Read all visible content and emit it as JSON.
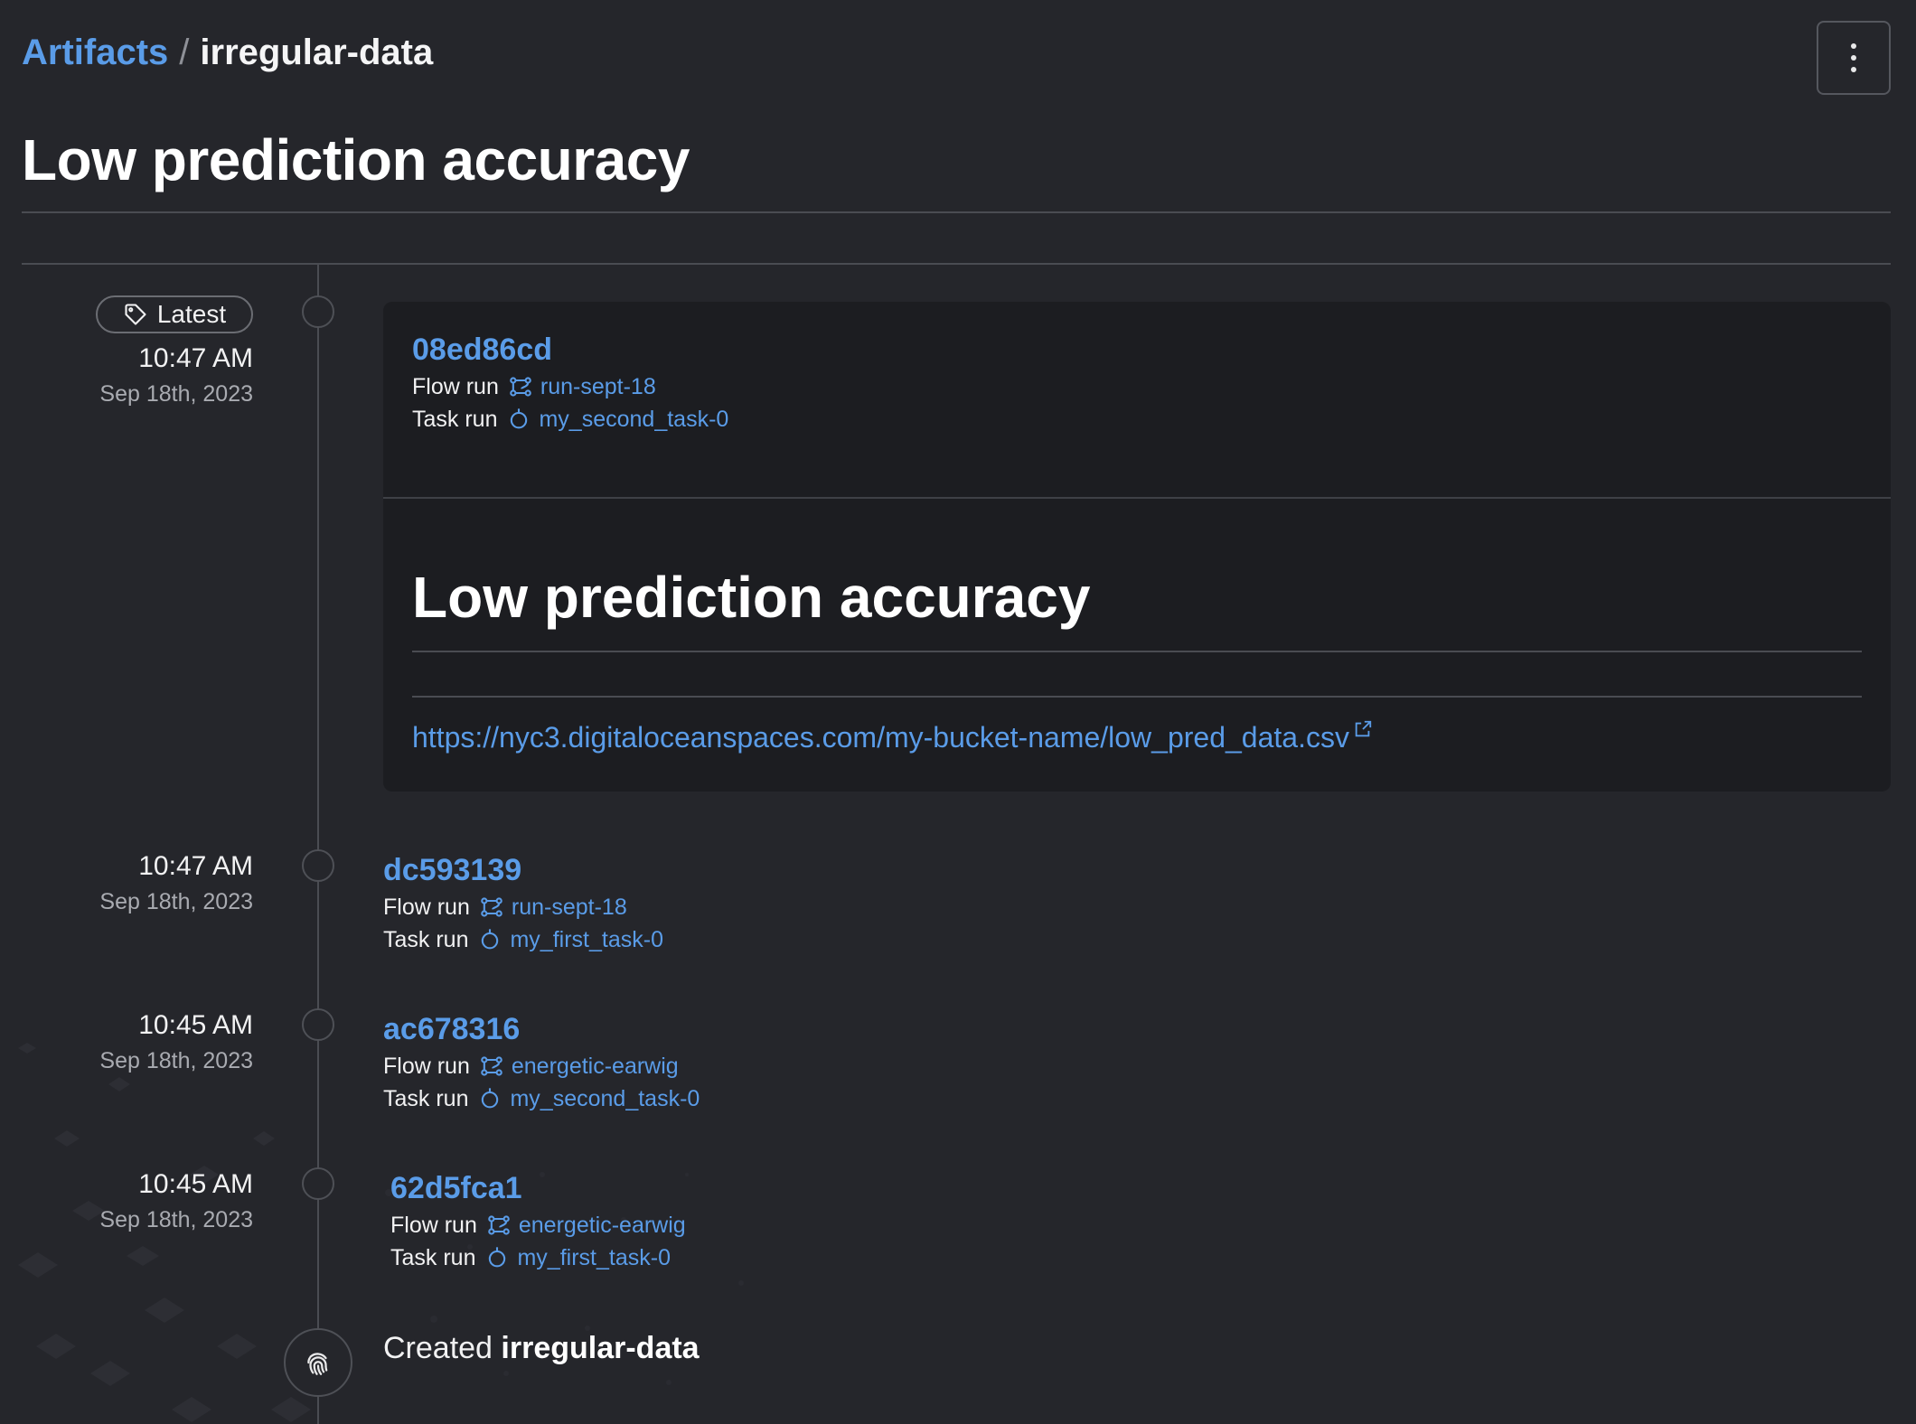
{
  "breadcrumb": {
    "parent": "Artifacts",
    "separator": "/",
    "current": "irregular-data"
  },
  "page_title": "Low prediction accuracy",
  "latest_badge": "Latest",
  "labels": {
    "flow_run": "Flow run",
    "task_run": "Task run"
  },
  "entries": [
    {
      "time": "10:47 AM",
      "date": "Sep 18th, 2023",
      "hash": "08ed86cd",
      "flow_run": "run-sept-18",
      "task_run": "my_second_task-0",
      "content": {
        "title": "Low prediction accuracy",
        "link": "https://nyc3.digitaloceanspaces.com/my-bucket-name/low_pred_data.csv"
      }
    },
    {
      "time": "10:47 AM",
      "date": "Sep 18th, 2023",
      "hash": "dc593139",
      "flow_run": "run-sept-18",
      "task_run": "my_first_task-0"
    },
    {
      "time": "10:45 AM",
      "date": "Sep 18th, 2023",
      "hash": "ac678316",
      "flow_run": "energetic-earwig",
      "task_run": "my_second_task-0"
    },
    {
      "time": "10:45 AM",
      "date": "Sep 18th, 2023",
      "hash": "62d5fca1",
      "flow_run": "energetic-earwig",
      "task_run": "my_first_task-0"
    }
  ],
  "created": {
    "prefix": "Created",
    "name": "irregular-data"
  },
  "colors": {
    "background": "#25262b",
    "card": "#1c1d21",
    "accent": "#5a9ce8",
    "border": "#4a4c52"
  },
  "icons": [
    "kebab-menu-icon",
    "tag-icon",
    "flow-run-icon",
    "task-run-icon",
    "external-link-icon",
    "fingerprint-icon"
  ]
}
